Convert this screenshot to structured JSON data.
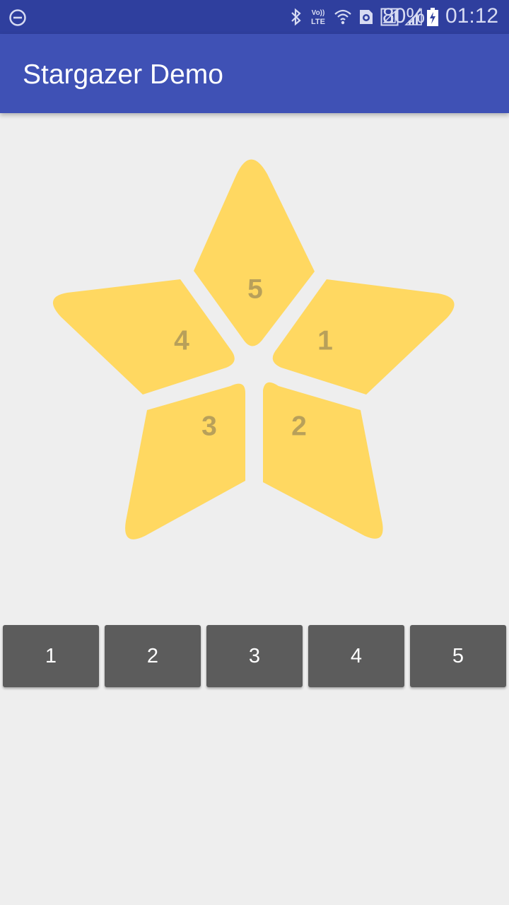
{
  "status_bar": {
    "battery_percent": "80%",
    "time": "01:12",
    "volte_label_top": "Vo))",
    "volte_label_bottom": "LTE",
    "icons": [
      "do-not-disturb-icon",
      "bluetooth-icon",
      "volte-icon",
      "wifi-icon",
      "data-saver-icon",
      "sim-signal-icon",
      "cell-signal-icon",
      "battery-charging-icon"
    ]
  },
  "app_bar": {
    "title": "Stargazer Demo"
  },
  "star": {
    "segments": [
      {
        "id": "1",
        "label": "1"
      },
      {
        "id": "2",
        "label": "2"
      },
      {
        "id": "3",
        "label": "3"
      },
      {
        "id": "4",
        "label": "4"
      },
      {
        "id": "5",
        "label": "5"
      }
    ],
    "fill_color": "#ffd861",
    "label_color": "#b8a05a"
  },
  "buttons": [
    {
      "label": "1"
    },
    {
      "label": "2"
    },
    {
      "label": "3"
    },
    {
      "label": "4"
    },
    {
      "label": "5"
    }
  ],
  "colors": {
    "status_bar": "#2f3f9e",
    "app_bar": "#3f51b5",
    "background": "#eeeeee",
    "button": "#5c5c5c"
  }
}
